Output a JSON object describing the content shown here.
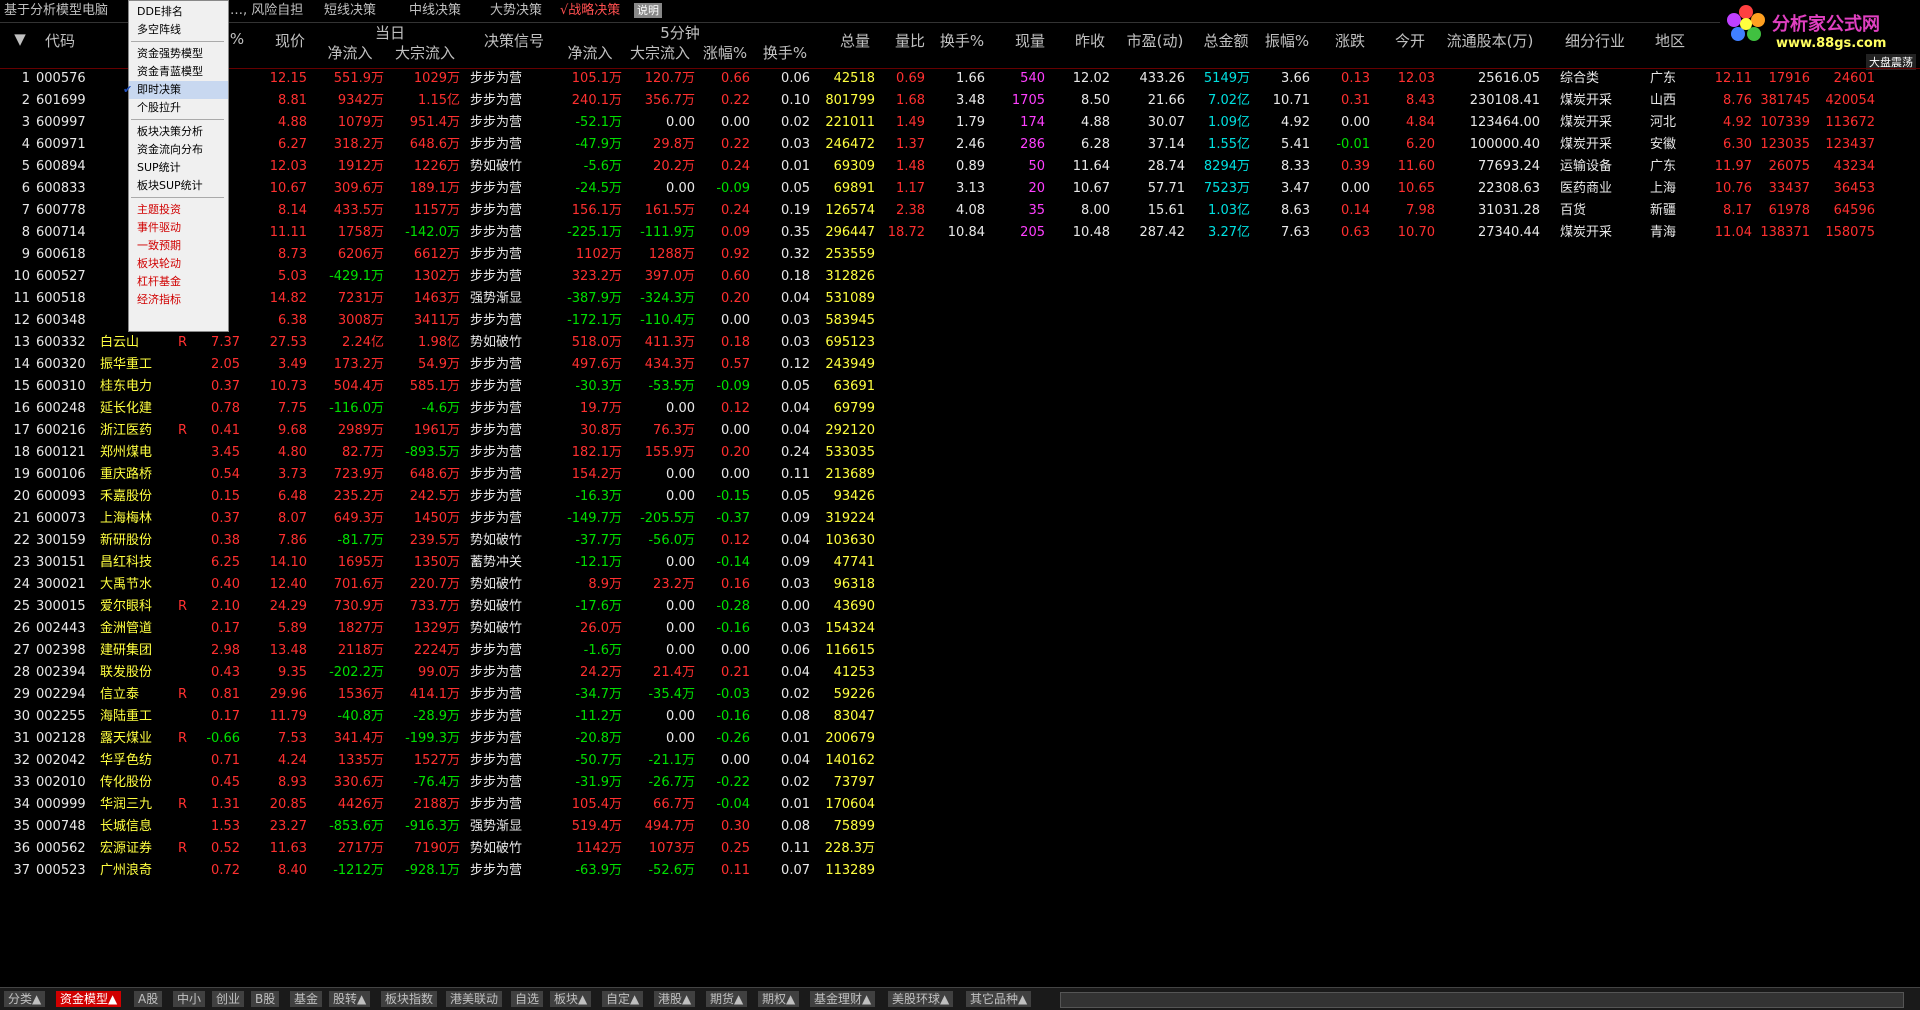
{
  "topbar": {
    "title": "基于分析模型电脑",
    "tabs": [
      "…, 风险自担",
      "短线决策",
      "中线决策",
      "大势决策",
      "√战略决策"
    ],
    "explain": "说明"
  },
  "logo": {
    "name": "分析家公式网",
    "url": "www.88gs.com",
    "dapan": "大盘震荡"
  },
  "menu": {
    "items": [
      "DDE排名",
      "多空阵线",
      "资金强势模型",
      "资金青蓝模型",
      "即时决策",
      "个股拉升",
      "板块决策分析",
      "资金流向分布",
      "SUP统计",
      "板块SUP统计",
      "主题投资",
      "事件驱动",
      "一致预期",
      "板块轮动",
      "杠杆基金",
      "经济指标"
    ],
    "checked_index": 4
  },
  "headers": {
    "code": "代码",
    "pct": "%",
    "price": "现价",
    "today": "当日",
    "netin": "净流入",
    "bigin": "大宗流入",
    "signal": "决策信号",
    "fivemin": "5分钟",
    "netin5": "净流入",
    "bigin5": "大宗流入",
    "amp5": "涨幅%",
    "turn5": "换手%",
    "vol": "总量",
    "volratio": "量比",
    "turn": "换手%",
    "cur": "现量",
    "prev": "昨收",
    "pe": "市盈(动)",
    "amt": "总金额",
    "amp": "振幅%",
    "chg": "涨跌",
    "open": "今开",
    "float": "流通股本(万)",
    "ind": "细分行业",
    "region": "地区"
  },
  "rows": [
    [
      "1",
      "000576",
      "",
      "",
      "",
      "12.15",
      "551.9万",
      "1029万",
      "步步为营",
      "105.1万",
      "120.7万",
      "0.66",
      "0.06",
      "42518",
      "0.69",
      "1.66",
      "540",
      "12.02",
      "433.26",
      "5149万",
      "3.66",
      "0.13",
      "12.03",
      "25616.05",
      "综合类",
      "广东",
      "12.11",
      "17916",
      "24601"
    ],
    [
      "2",
      "601699",
      "",
      "",
      "",
      "8.81",
      "9342万",
      "1.15亿",
      "步步为营",
      "240.1万",
      "356.7万",
      "0.22",
      "0.10",
      "801799",
      "1.68",
      "3.48",
      "1705",
      "8.50",
      "21.66",
      "7.02亿",
      "10.71",
      "0.31",
      "8.43",
      "230108.41",
      "煤炭开采",
      "山西",
      "8.76",
      "381745",
      "420054"
    ],
    [
      "3",
      "600997",
      "",
      "",
      "",
      "4.88",
      "1079万",
      "951.4万",
      "步步为营",
      "-52.1万",
      "0.00",
      "0.00",
      "0.02",
      "221011",
      "1.49",
      "1.79",
      "174",
      "4.88",
      "30.07",
      "1.09亿",
      "4.92",
      "0.00",
      "4.84",
      "123464.00",
      "煤炭开采",
      "河北",
      "4.92",
      "107339",
      "113672"
    ],
    [
      "4",
      "600971",
      "",
      "",
      "",
      "6.27",
      "318.2万",
      "648.6万",
      "步步为营",
      "-47.9万",
      "29.8万",
      "0.22",
      "0.03",
      "246472",
      "1.37",
      "2.46",
      "286",
      "6.28",
      "37.14",
      "1.55亿",
      "5.41",
      "-0.01",
      "6.20",
      "100000.40",
      "煤炭开采",
      "安徽",
      "6.30",
      "123035",
      "123437"
    ],
    [
      "5",
      "600894",
      "",
      "",
      "",
      "12.03",
      "1912万",
      "1226万",
      "势如破竹",
      "-5.6万",
      "20.2万",
      "0.24",
      "0.01",
      "69309",
      "1.48",
      "0.89",
      "50",
      "11.64",
      "28.74",
      "8294万",
      "8.33",
      "0.39",
      "11.60",
      "77693.24",
      "运输设备",
      "广东",
      "11.97",
      "26075",
      "43234"
    ],
    [
      "6",
      "600833",
      "",
      "",
      "",
      "10.67",
      "309.6万",
      "189.1万",
      "步步为营",
      "-24.5万",
      "0.00",
      "-0.09",
      "0.05",
      "69891",
      "1.17",
      "3.13",
      "20",
      "10.67",
      "57.71",
      "7523万",
      "3.47",
      "0.00",
      "10.65",
      "22308.63",
      "医药商业",
      "上海",
      "10.76",
      "33437",
      "36453"
    ],
    [
      "7",
      "600778",
      "",
      "",
      "",
      "8.14",
      "433.5万",
      "1157万",
      "步步为营",
      "156.1万",
      "161.5万",
      "0.24",
      "0.19",
      "126574",
      "2.38",
      "4.08",
      "35",
      "8.00",
      "15.61",
      "1.03亿",
      "8.63",
      "0.14",
      "7.98",
      "31031.28",
      "百货",
      "新疆",
      "8.17",
      "61978",
      "64596"
    ],
    [
      "8",
      "600714",
      "",
      "",
      "",
      "11.11",
      "1758万",
      "-142.0万",
      "步步为营",
      "-225.1万",
      "-111.9万",
      "0.09",
      "0.35",
      "296447",
      "18.72",
      "10.84",
      "205",
      "10.48",
      "287.42",
      "3.27亿",
      "7.63",
      "0.63",
      "10.70",
      "27340.44",
      "煤炭开采",
      "青海",
      "11.04",
      "138371",
      "158075"
    ],
    [
      "9",
      "600618",
      "",
      "",
      "",
      "8.73",
      "6206万",
      "6612万",
      "步步为营",
      "1102万",
      "1288万",
      "0.92",
      "0.32",
      "253559"
    ],
    [
      "10",
      "600527",
      "",
      "",
      "",
      "5.03",
      "-429.1万",
      "1302万",
      "步步为营",
      "323.2万",
      "397.0万",
      "0.60",
      "0.18",
      "312826"
    ],
    [
      "11",
      "600518",
      "",
      "",
      "",
      "14.82",
      "7231万",
      "1463万",
      "强势渐显",
      "-387.9万",
      "-324.3万",
      "0.20",
      "0.04",
      "531089"
    ],
    [
      "12",
      "600348",
      "",
      "",
      "",
      "6.38",
      "3008万",
      "3411万",
      "步步为营",
      "-172.1万",
      "-110.4万",
      "0.00",
      "0.03",
      "583945"
    ],
    [
      "13",
      "600332",
      "白云山",
      "R",
      "7.37",
      "27.53",
      "2.24亿",
      "1.98亿",
      "势如破竹",
      "518.0万",
      "411.3万",
      "0.18",
      "0.03",
      "695123"
    ],
    [
      "14",
      "600320",
      "振华重工",
      "",
      "2.05",
      "3.49",
      "173.2万",
      "54.9万",
      "步步为营",
      "497.6万",
      "434.3万",
      "0.57",
      "0.12",
      "243949"
    ],
    [
      "15",
      "600310",
      "桂东电力",
      "",
      "0.37",
      "10.73",
      "504.4万",
      "585.1万",
      "步步为营",
      "-30.3万",
      "-53.5万",
      "-0.09",
      "0.05",
      "63691"
    ],
    [
      "16",
      "600248",
      "延长化建",
      "",
      "0.78",
      "7.75",
      "-116.0万",
      "-4.6万",
      "步步为营",
      "19.7万",
      "0.00",
      "0.12",
      "0.04",
      "69799"
    ],
    [
      "17",
      "600216",
      "浙江医药",
      "R",
      "0.41",
      "9.68",
      "2989万",
      "1961万",
      "步步为营",
      "30.8万",
      "76.3万",
      "0.00",
      "0.04",
      "292120"
    ],
    [
      "18",
      "600121",
      "郑州煤电",
      "",
      "3.45",
      "4.80",
      "82.7万",
      "-893.5万",
      "步步为营",
      "182.1万",
      "155.9万",
      "0.20",
      "0.24",
      "533035"
    ],
    [
      "19",
      "600106",
      "重庆路桥",
      "",
      "0.54",
      "3.73",
      "723.9万",
      "648.6万",
      "步步为营",
      "154.2万",
      "0.00",
      "0.00",
      "0.11",
      "213689"
    ],
    [
      "20",
      "600093",
      "禾嘉股份",
      "",
      "0.15",
      "6.48",
      "235.2万",
      "242.5万",
      "步步为营",
      "-16.3万",
      "0.00",
      "-0.15",
      "0.05",
      "93426"
    ],
    [
      "21",
      "600073",
      "上海梅林",
      "",
      "0.37",
      "8.07",
      "649.3万",
      "1450万",
      "步步为营",
      "-149.7万",
      "-205.5万",
      "-0.37",
      "0.09",
      "319224"
    ],
    [
      "22",
      "300159",
      "新研股份",
      "",
      "0.38",
      "7.86",
      "-81.7万",
      "239.5万",
      "势如破竹",
      "-37.7万",
      "-56.0万",
      "0.12",
      "0.04",
      "103630"
    ],
    [
      "23",
      "300151",
      "昌红科技",
      "",
      "6.25",
      "14.10",
      "1695万",
      "1350万",
      "蓄势冲关",
      "-12.1万",
      "0.00",
      "-0.14",
      "0.09",
      "47741"
    ],
    [
      "24",
      "300021",
      "大禹节水",
      "",
      "0.40",
      "12.40",
      "701.6万",
      "220.7万",
      "势如破竹",
      "8.9万",
      "23.2万",
      "0.16",
      "0.03",
      "96318"
    ],
    [
      "25",
      "300015",
      "爱尔眼科",
      "R",
      "2.10",
      "24.29",
      "730.9万",
      "733.7万",
      "势如破竹",
      "-17.6万",
      "0.00",
      "-0.28",
      "0.00",
      "43690"
    ],
    [
      "26",
      "002443",
      "金洲管道",
      "",
      "0.17",
      "5.89",
      "1827万",
      "1329万",
      "势如破竹",
      "26.0万",
      "0.00",
      "-0.16",
      "0.03",
      "154324"
    ],
    [
      "27",
      "002398",
      "建研集团",
      "",
      "2.98",
      "13.48",
      "2118万",
      "2224万",
      "步步为营",
      "-1.6万",
      "0.00",
      "0.00",
      "0.06",
      "116615"
    ],
    [
      "28",
      "002394",
      "联发股份",
      "",
      "0.43",
      "9.35",
      "-202.2万",
      "99.0万",
      "步步为营",
      "24.2万",
      "21.4万",
      "0.21",
      "0.04",
      "41253"
    ],
    [
      "29",
      "002294",
      "信立泰",
      "R",
      "0.81",
      "29.96",
      "1536万",
      "414.1万",
      "步步为营",
      "-34.7万",
      "-35.4万",
      "-0.03",
      "0.02",
      "59226"
    ],
    [
      "30",
      "002255",
      "海陆重工",
      "",
      "0.17",
      "11.79",
      "-40.8万",
      "-28.9万",
      "步步为营",
      "-11.2万",
      "0.00",
      "-0.16",
      "0.08",
      "83047"
    ],
    [
      "31",
      "002128",
      "露天煤业",
      "R",
      "-0.66",
      "7.53",
      "341.4万",
      "-199.3万",
      "步步为营",
      "-20.8万",
      "0.00",
      "-0.26",
      "0.01",
      "200679"
    ],
    [
      "32",
      "002042",
      "华孚色纺",
      "",
      "0.71",
      "4.24",
      "1335万",
      "1527万",
      "步步为营",
      "-50.7万",
      "-21.1万",
      "0.00",
      "0.04",
      "140162"
    ],
    [
      "33",
      "002010",
      "传化股份",
      "",
      "0.45",
      "8.93",
      "330.6万",
      "-76.4万",
      "步步为营",
      "-31.9万",
      "-26.7万",
      "-0.22",
      "0.02",
      "73797"
    ],
    [
      "34",
      "000999",
      "华润三九",
      "R",
      "1.31",
      "20.85",
      "4426万",
      "2188万",
      "步步为营",
      "105.4万",
      "66.7万",
      "-0.04",
      "0.01",
      "170604"
    ],
    [
      "35",
      "000748",
      "长城信息",
      "",
      "1.53",
      "23.27",
      "-853.6万",
      "-916.3万",
      "强势渐显",
      "519.4万",
      "494.7万",
      "0.30",
      "0.08",
      "75899"
    ],
    [
      "36",
      "000562",
      "宏源证券",
      "R",
      "0.52",
      "11.63",
      "2717万",
      "7190万",
      "势如破竹",
      "1142万",
      "1073万",
      "0.25",
      "0.11",
      "228.3万"
    ],
    [
      "37",
      "000523",
      "广州浪奇",
      "",
      "0.72",
      "8.40",
      "-1212万",
      "-928.1万",
      "步步为营",
      "-63.9万",
      "-52.6万",
      "0.11",
      "0.07",
      "113289"
    ]
  ],
  "bottom": {
    "tabs": [
      "分类▲",
      "资金模型▲",
      "A股",
      "中小",
      "创业",
      "B股",
      "基金",
      "股转▲",
      "板块指数",
      "港美联动",
      "自选",
      "板块▲",
      "自定▲",
      "港股▲",
      "期货▲",
      "期权▲",
      "基金理财▲",
      "美股环球▲",
      "其它品种▲"
    ],
    "active_index": 1
  }
}
